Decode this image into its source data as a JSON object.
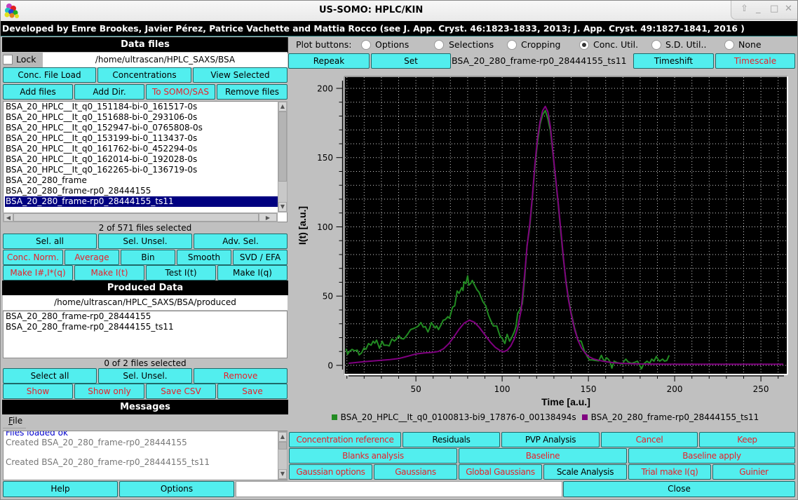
{
  "window": {
    "title": "US-SOMO: HPLC/KIN",
    "controls": {
      "shade": "⇧",
      "minimize": "_",
      "maximize": "□",
      "close": "✕"
    }
  },
  "credits": "Developed by Emre Brookes, Javier Pérez, Patrice Vachette and Mattia Rocco (see J. App. Cryst. 46:1823-1833, 2013; J. App. Cryst. 49:1827-1841, 2016 )",
  "colors": {
    "button_bg": "#52eeee",
    "alert_text": "#e8202a",
    "normal_text": "#000000",
    "selection_bg": "#000080",
    "series_green": "#228b22",
    "series_purple": "#800080",
    "message_info": "#0000cc",
    "message_text": "#777777"
  },
  "data_files": {
    "header": "Data files",
    "lock_label": "Lock",
    "lock_checked": false,
    "path": "/home/ultrascan/HPLC_SAXS/BSA",
    "files": [
      "BSA_20_HPLC__It_q0_151184-bi-0_161517-0s",
      "BSA_20_HPLC__It_q0_151688-bi-0_293106-0s",
      "BSA_20_HPLC__It_q0_152947-bi-0_0765808-0s",
      "BSA_20_HPLC__It_q0_153199-bi-0_113437-0s",
      "BSA_20_HPLC__It_q0_161762-bi-0_452294-0s",
      "BSA_20_HPLC__It_q0_162014-bi-0_192028-0s",
      "BSA_20_HPLC__It_q0_162265-bi-0_136719-0s",
      "BSA_20_280_frame",
      "BSA_20_280_frame-rp0_28444155",
      "BSA_20_280_frame-rp0_28444155_ts11"
    ],
    "selected_index": 9,
    "status": "2 of 571 files selected"
  },
  "produced": {
    "header": "Produced Data",
    "path": "/home/ultrascan/HPLC_SAXS/BSA/produced",
    "files": [
      "BSA_20_280_frame-rp0_28444155",
      "BSA_20_280_frame-rp0_28444155_ts11"
    ],
    "status": "0 of 2 files selected"
  },
  "messages": {
    "header": "Messages",
    "menu_file": "File",
    "lines": [
      {
        "text": "Files loaded ok",
        "color": "#0000cc"
      },
      {
        "text": "Created BSA_20_280_frame-rp0_28444155",
        "color": "#777777"
      },
      {
        "text": "",
        "color": "#777777"
      },
      {
        "text": "Created BSA_20_280_frame-rp0_28444155_ts11",
        "color": "#777777"
      }
    ]
  },
  "plot_buttons": {
    "label": "Plot buttons:",
    "options": [
      {
        "label": "Options",
        "checked": false
      },
      {
        "label": "Selections",
        "checked": false
      },
      {
        "label": "Cropping",
        "checked": false
      },
      {
        "label": "Conc. Util.",
        "checked": true
      },
      {
        "label": "S.D. Util..",
        "checked": false
      },
      {
        "label": "None",
        "checked": false
      }
    ]
  },
  "current_file": "BSA_20_280_frame-rp0_28444155_ts11",
  "status_input": {
    "value": ""
  },
  "buttons": {
    "conc_file_load": {
      "label": "Conc. File Load",
      "color": "#000000"
    },
    "concentrations": {
      "label": "Concentrations",
      "color": "#000000"
    },
    "view_selected": {
      "label": "View Selected",
      "color": "#000000"
    },
    "add_files": {
      "label": "Add files",
      "color": "#000000"
    },
    "add_dir": {
      "label": "Add Dir.",
      "color": "#000000"
    },
    "to_somo_sas": {
      "label": "To SOMO/SAS",
      "color": "#e8202a"
    },
    "remove_files": {
      "label": "Remove files",
      "color": "#000000"
    },
    "sel_all": {
      "label": "Sel. all",
      "color": "#000000"
    },
    "sel_unsel": {
      "label": "Sel. Unsel.",
      "color": "#000000"
    },
    "adv_sel": {
      "label": "Adv. Sel.",
      "color": "#000000"
    },
    "conc_norm": {
      "label": "Conc. Norm.",
      "color": "#e8202a"
    },
    "average": {
      "label": "Average",
      "color": "#e8202a"
    },
    "bin": {
      "label": "Bin",
      "color": "#000000"
    },
    "smooth": {
      "label": "Smooth",
      "color": "#000000"
    },
    "svd_efa": {
      "label": "SVD / EFA",
      "color": "#000000"
    },
    "make_ihash": {
      "label": "Make I#,I*(q)",
      "color": "#e8202a"
    },
    "make_it": {
      "label": "Make I(t)",
      "color": "#e8202a"
    },
    "test_it": {
      "label": "Test I(t)",
      "color": "#000000"
    },
    "make_iq": {
      "label": "Make I(q)",
      "color": "#000000"
    },
    "prod_select_all": {
      "label": "Select all",
      "color": "#000000"
    },
    "prod_sel_unsel": {
      "label": "Sel. Unsel.",
      "color": "#000000"
    },
    "prod_remove": {
      "label": "Remove",
      "color": "#e8202a"
    },
    "show": {
      "label": "Show",
      "color": "#e8202a"
    },
    "show_only": {
      "label": "Show only",
      "color": "#e8202a"
    },
    "save_csv": {
      "label": "Save CSV",
      "color": "#e8202a"
    },
    "save": {
      "label": "Save",
      "color": "#e8202a"
    },
    "help": {
      "label": "Help",
      "color": "#000000"
    },
    "options": {
      "label": "Options",
      "color": "#000000"
    },
    "close": {
      "label": "Close",
      "color": "#000000"
    },
    "repeak": {
      "label": "Repeak",
      "color": "#000000"
    },
    "set": {
      "label": "Set",
      "color": "#000000"
    },
    "timeshift": {
      "label": "Timeshift",
      "color": "#000000"
    },
    "timescale": {
      "label": "Timescale",
      "color": "#e8202a"
    },
    "concentration_reference": {
      "label": "Concentration reference",
      "color": "#e8202a"
    },
    "residuals": {
      "label": "Residuals",
      "color": "#000000"
    },
    "pvp_analysis": {
      "label": "PVP Analysis",
      "color": "#000000"
    },
    "cancel": {
      "label": "Cancel",
      "color": "#e8202a"
    },
    "keep": {
      "label": "Keep",
      "color": "#e8202a"
    },
    "blanks_analysis": {
      "label": "Blanks analysis",
      "color": "#e8202a"
    },
    "baseline": {
      "label": "Baseline",
      "color": "#e8202a"
    },
    "baseline_apply": {
      "label": "Baseline apply",
      "color": "#e8202a"
    },
    "gaussian_options": {
      "label": "Gaussian options",
      "color": "#e8202a"
    },
    "gaussians": {
      "label": "Gaussians",
      "color": "#e8202a"
    },
    "global_gaussians": {
      "label": "Global Gaussians",
      "color": "#e8202a"
    },
    "scale_analysis": {
      "label": "Scale Analysis",
      "color": "#000000"
    },
    "trial_make_iq": {
      "label": "Trial make I(q)",
      "color": "#e8202a"
    },
    "guinier": {
      "label": "Guinier",
      "color": "#e8202a"
    }
  },
  "chart_data": {
    "type": "line",
    "title": "",
    "xlabel": "Time [a.u.]",
    "ylabel": "I(t) [a.u.]",
    "xlim": [
      8.9,
      265
    ],
    "ylim": [
      -6.1,
      208.1
    ],
    "xticks": [
      50,
      100,
      150,
      200,
      250
    ],
    "yticks": [
      0,
      50,
      100,
      150,
      200
    ],
    "x_minor_step": 10,
    "y_minor_step": 10,
    "grid": true,
    "legend_position": "bottom",
    "series": [
      {
        "name": "BSA_20_HPLC__It_q0_0100813-bi9_17876-0_00138494s",
        "color": "#228b22",
        "points": [
          [
            9.5,
            12
          ],
          [
            10.4,
            8
          ],
          [
            11.5,
            10
          ],
          [
            13,
            11.5
          ],
          [
            14.5,
            10.5
          ],
          [
            16,
            11
          ],
          [
            17.1,
            7.5
          ],
          [
            18.5,
            9
          ],
          [
            19.9,
            12.5
          ],
          [
            21,
            11.5
          ],
          [
            22.5,
            15.7
          ],
          [
            24,
            14.5
          ],
          [
            25.2,
            17.4
          ],
          [
            26.2,
            16
          ],
          [
            27.2,
            18.2
          ],
          [
            28.9,
            12.3
          ],
          [
            30,
            16
          ],
          [
            30.5,
            17.4
          ],
          [
            31.5,
            14.5
          ],
          [
            33.4,
            14.5
          ],
          [
            34.5,
            14
          ],
          [
            36.1,
            19
          ],
          [
            37.5,
            17.5
          ],
          [
            38.8,
            19
          ],
          [
            40.1,
            21.6
          ],
          [
            41.2,
            19.5
          ],
          [
            42.8,
            19
          ],
          [
            44,
            20.5
          ],
          [
            45.5,
            23
          ],
          [
            46.9,
            25.8
          ],
          [
            48.5,
            26.5
          ],
          [
            50.3,
            27.5
          ],
          [
            51.5,
            28.5
          ],
          [
            52.9,
            30.9
          ],
          [
            54.3,
            27.5
          ],
          [
            55.5,
            28
          ],
          [
            57,
            24.1
          ],
          [
            58,
            27
          ],
          [
            59,
            30.9
          ],
          [
            60,
            29
          ],
          [
            61.2,
            27
          ],
          [
            62,
            28.5
          ],
          [
            63.1,
            25.8
          ],
          [
            64.5,
            29
          ],
          [
            65.8,
            32.6
          ],
          [
            67,
            33
          ],
          [
            68.5,
            35.1
          ],
          [
            69.5,
            34
          ],
          [
            71.2,
            41.9
          ],
          [
            72.5,
            43
          ],
          [
            73.9,
            53.7
          ],
          [
            75,
            52
          ],
          [
            76.6,
            56.2
          ],
          [
            77.3,
            54
          ],
          [
            77.9,
            60.4
          ],
          [
            79,
            59
          ],
          [
            80,
            64.6
          ],
          [
            80.7,
            57.9
          ],
          [
            81.7,
            59
          ],
          [
            82.7,
            61.3
          ],
          [
            84,
            58
          ],
          [
            85.4,
            54.5
          ],
          [
            86.5,
            53
          ],
          [
            88.8,
            46
          ],
          [
            90.5,
            43
          ],
          [
            92.1,
            36
          ],
          [
            93.5,
            32
          ],
          [
            94.9,
            28.4
          ],
          [
            96.9,
            28.4
          ],
          [
            98,
            24
          ],
          [
            98.9,
            20.8
          ],
          [
            100,
            19.5
          ],
          [
            101.6,
            15.7
          ],
          [
            102.9,
            22.4
          ],
          [
            104.3,
            17.4
          ],
          [
            105.5,
            20
          ],
          [
            107,
            24.1
          ],
          [
            108,
            28
          ],
          [
            109,
            37.6
          ],
          [
            110.2,
            40
          ],
          [
            111.7,
            44.4
          ],
          [
            113,
            62
          ],
          [
            114.4,
            86
          ],
          [
            116,
            100
          ],
          [
            117.5,
            121
          ],
          [
            119,
            143
          ],
          [
            120.5,
            161
          ],
          [
            122,
            174
          ],
          [
            123.5,
            181
          ],
          [
            125,
            184
          ],
          [
            126.5,
            178
          ],
          [
            128,
            169
          ],
          [
            129.5,
            152
          ],
          [
            131,
            134
          ],
          [
            132.5,
            116
          ],
          [
            134,
            96
          ],
          [
            135.5,
            77
          ],
          [
            137,
            61
          ],
          [
            138.5,
            48
          ],
          [
            140,
            38
          ],
          [
            142,
            27
          ],
          [
            144,
            18
          ],
          [
            145.8,
            17.4
          ],
          [
            147.5,
            11
          ],
          [
            149.3,
            6.4
          ],
          [
            150.6,
            3.9
          ],
          [
            152,
            4
          ],
          [
            154,
            3.5
          ],
          [
            156,
            3.2
          ],
          [
            157.5,
            7.2
          ],
          [
            158.5,
            4.5
          ],
          [
            159.5,
            3
          ],
          [
            160.5,
            5.5
          ],
          [
            161.5,
            4.5
          ],
          [
            162.5,
            2.5
          ],
          [
            163.6,
            -2
          ],
          [
            164.9,
            3
          ],
          [
            166.5,
            2
          ],
          [
            168,
            1.5
          ],
          [
            169.7,
            0.9
          ],
          [
            170.7,
            3
          ],
          [
            171.7,
            4.5
          ],
          [
            173,
            2.5
          ],
          [
            175,
            1.4
          ],
          [
            176.5,
            2
          ],
          [
            178.4,
            3
          ],
          [
            179.5,
            0.5
          ],
          [
            180.8,
            -2.5
          ],
          [
            182,
            1
          ],
          [
            183,
            2
          ],
          [
            184,
            3
          ],
          [
            185.5,
            1.5
          ],
          [
            186.7,
            4.5
          ],
          [
            188,
            3
          ],
          [
            189.4,
            6.4
          ],
          [
            190.5,
            4
          ],
          [
            191.4,
            3
          ],
          [
            193,
            4.5
          ],
          [
            194.1,
            3
          ],
          [
            195.5,
            3.5
          ],
          [
            196.8,
            7.2
          ]
        ]
      },
      {
        "name": "BSA_20_280_frame-rp0_28444155_ts11",
        "color": "#800080",
        "points": [
          [
            11,
            1.5
          ],
          [
            15,
            2.0
          ],
          [
            20,
            2.6
          ],
          [
            25,
            3.1
          ],
          [
            30,
            3.6
          ],
          [
            35,
            4.2
          ],
          [
            40,
            4.9
          ],
          [
            45,
            6.5
          ],
          [
            50,
            8.2
          ],
          [
            55,
            9.0
          ],
          [
            60,
            9.4
          ],
          [
            63,
            10.0
          ],
          [
            66,
            12
          ],
          [
            69,
            15.5
          ],
          [
            72,
            20.5
          ],
          [
            75,
            26
          ],
          [
            78,
            30.5
          ],
          [
            81,
            32.6
          ],
          [
            84,
            31
          ],
          [
            87,
            27
          ],
          [
            90,
            22
          ],
          [
            93,
            17
          ],
          [
            96,
            13
          ],
          [
            99,
            10.5
          ],
          [
            101,
            9.8
          ],
          [
            103,
            11
          ],
          [
            105,
            14
          ],
          [
            107,
            19
          ],
          [
            109,
            27
          ],
          [
            111,
            40
          ],
          [
            113,
            65
          ],
          [
            114.5,
            87
          ],
          [
            116,
            102
          ],
          [
            117.5,
            122
          ],
          [
            119,
            145
          ],
          [
            120.5,
            164
          ],
          [
            122,
            176
          ],
          [
            123.5,
            184
          ],
          [
            125,
            187
          ],
          [
            126.5,
            183
          ],
          [
            128,
            172
          ],
          [
            129.5,
            153
          ],
          [
            131,
            135
          ],
          [
            132.5,
            117
          ],
          [
            134,
            98
          ],
          [
            135.5,
            78
          ],
          [
            137,
            60
          ],
          [
            138.5,
            47
          ],
          [
            140,
            37
          ],
          [
            142,
            26
          ],
          [
            144,
            18
          ],
          [
            146,
            12.5
          ],
          [
            148,
            9
          ],
          [
            150,
            6.4
          ],
          [
            153,
            4.6
          ],
          [
            156,
            3.6
          ],
          [
            160,
            2.6
          ],
          [
            165,
            1.8
          ],
          [
            170,
            1.4
          ],
          [
            180,
            1.0
          ],
          [
            190,
            0.9
          ],
          [
            200,
            0.8
          ],
          [
            230,
            0.8
          ],
          [
            263,
            0.8
          ]
        ]
      }
    ]
  }
}
